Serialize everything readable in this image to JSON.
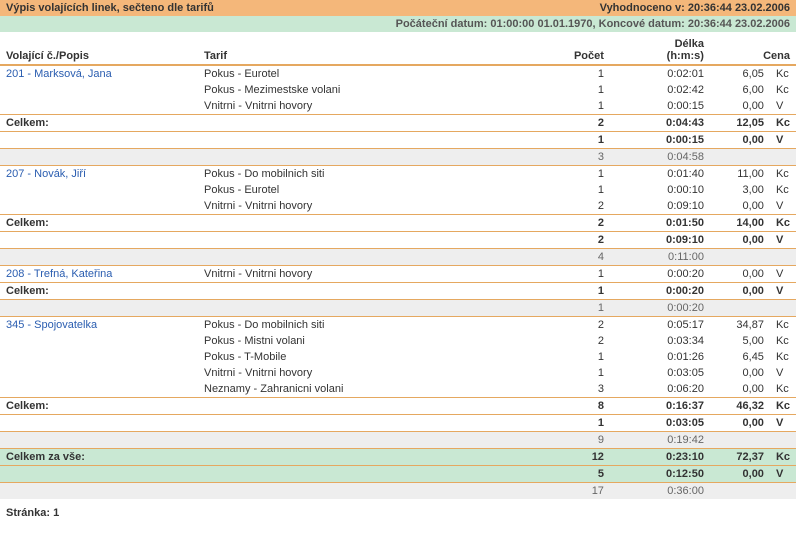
{
  "header": {
    "title_left": "Výpis volajících linek, sečteno dle tarifů",
    "title_right": "Vyhodnoceno v: 20:36:44 23.02.2006",
    "date_line": "Počáteční datum: 01:00:00 01.01.1970, Koncové datum: 20:36:44 23.02.2006"
  },
  "columns": {
    "caller": "Volající č./Popis",
    "tarif": "Tarif",
    "pocet": "Počet",
    "delka": "Délka",
    "delka_sub": "(h:m:s)",
    "cena": "Cena"
  },
  "labels": {
    "celkem": "Celkem:",
    "celkem_vse": "Celkem za vše:",
    "stranka": "Stránka: 1"
  },
  "groups": [
    {
      "caller": "201 - Marksová, Jana",
      "rows": [
        {
          "tarif": "Pokus - Eurotel",
          "pocet": "1",
          "delka": "0:02:01",
          "cena": "6,05",
          "unit": "Kc"
        },
        {
          "tarif": "Pokus - Mezimestske volani",
          "pocet": "1",
          "delka": "0:02:42",
          "cena": "6,00",
          "unit": "Kc"
        },
        {
          "tarif": "Vnitrni - Vnitrni hovory",
          "pocet": "1",
          "delka": "0:00:15",
          "cena": "0,00",
          "unit": "V"
        }
      ],
      "totals": [
        {
          "pocet": "2",
          "delka": "0:04:43",
          "cena": "12,05",
          "unit": "Kc"
        },
        {
          "pocet": "1",
          "delka": "0:00:15",
          "cena": "0,00",
          "unit": "V"
        }
      ],
      "sub": {
        "pocet": "3",
        "delka": "0:04:58"
      }
    },
    {
      "caller": "207 - Novák, Jiří",
      "rows": [
        {
          "tarif": "Pokus - Do mobilnich siti",
          "pocet": "1",
          "delka": "0:01:40",
          "cena": "11,00",
          "unit": "Kc"
        },
        {
          "tarif": "Pokus - Eurotel",
          "pocet": "1",
          "delka": "0:00:10",
          "cena": "3,00",
          "unit": "Kc"
        },
        {
          "tarif": "Vnitrni - Vnitrni hovory",
          "pocet": "2",
          "delka": "0:09:10",
          "cena": "0,00",
          "unit": "V"
        }
      ],
      "totals": [
        {
          "pocet": "2",
          "delka": "0:01:50",
          "cena": "14,00",
          "unit": "Kc"
        },
        {
          "pocet": "2",
          "delka": "0:09:10",
          "cena": "0,00",
          "unit": "V"
        }
      ],
      "sub": {
        "pocet": "4",
        "delka": "0:11:00"
      }
    },
    {
      "caller": "208 - Trefná, Kateřina",
      "rows": [
        {
          "tarif": "Vnitrni - Vnitrni hovory",
          "pocet": "1",
          "delka": "0:00:20",
          "cena": "0,00",
          "unit": "V"
        }
      ],
      "totals": [
        {
          "pocet": "1",
          "delka": "0:00:20",
          "cena": "0,00",
          "unit": "V"
        }
      ],
      "sub": {
        "pocet": "1",
        "delka": "0:00:20"
      }
    },
    {
      "caller": "345 - Spojovatelka",
      "rows": [
        {
          "tarif": "Pokus - Do mobilnich siti",
          "pocet": "2",
          "delka": "0:05:17",
          "cena": "34,87",
          "unit": "Kc"
        },
        {
          "tarif": "Pokus - Mistni volani",
          "pocet": "2",
          "delka": "0:03:34",
          "cena": "5,00",
          "unit": "Kc"
        },
        {
          "tarif": "Pokus - T-Mobile",
          "pocet": "1",
          "delka": "0:01:26",
          "cena": "6,45",
          "unit": "Kc"
        },
        {
          "tarif": "Vnitrni - Vnitrni hovory",
          "pocet": "1",
          "delka": "0:03:05",
          "cena": "0,00",
          "unit": "V"
        },
        {
          "tarif": "Neznamy - Zahranicni volani",
          "pocet": "3",
          "delka": "0:06:20",
          "cena": "0,00",
          "unit": "Kc"
        }
      ],
      "totals": [
        {
          "pocet": "8",
          "delka": "0:16:37",
          "cena": "46,32",
          "unit": "Kc"
        },
        {
          "pocet": "1",
          "delka": "0:03:05",
          "cena": "0,00",
          "unit": "V"
        }
      ],
      "sub": {
        "pocet": "9",
        "delka": "0:19:42"
      }
    }
  ],
  "grand": {
    "rows": [
      {
        "pocet": "12",
        "delka": "0:23:10",
        "cena": "72,37",
        "unit": "Kc"
      },
      {
        "pocet": "5",
        "delka": "0:12:50",
        "cena": "0,00",
        "unit": "V"
      }
    ],
    "sub": {
      "pocet": "17",
      "delka": "0:36:00"
    }
  }
}
